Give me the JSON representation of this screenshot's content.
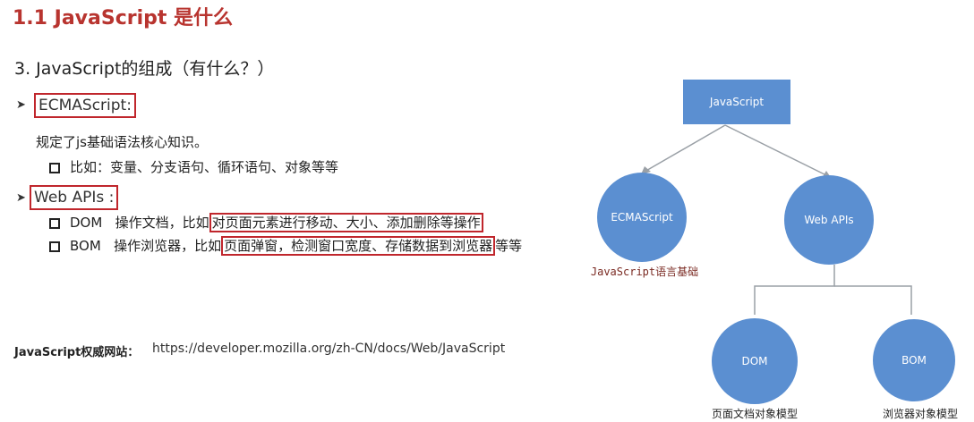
{
  "title": "1.1 JavaScript 是什么",
  "heading": "3. JavaScript的组成（有什么？）",
  "ecma": {
    "label": "ECMAScript:",
    "desc": "规定了js基础语法核心知识。",
    "example": "比如：变量、分支语句、循环语句、对象等等"
  },
  "webapis": {
    "label": "Web APIs :",
    "dom_prefix": "DOM   操作文档，比如",
    "dom_highlight": "对页面元素进行移动、大小、添加删除等操作",
    "bom_prefix": "BOM   操作浏览器，比如",
    "bom_highlight": "页面弹窗，检测窗口宽度、存储数据到浏览器",
    "bom_suffix": "等等"
  },
  "site": {
    "label": "JavaScript权威网站：",
    "url": "https://developer.mozilla.org/zh-CN/docs/Web/JavaScript"
  },
  "diagram": {
    "root": "JavaScript",
    "ecma_node": "ECMAScript",
    "ecma_sub": "JavaScript语言基础",
    "webapis_node": "Web APIs",
    "dom_node": "DOM",
    "dom_sub": "页面文档对象模型",
    "bom_node": "BOM",
    "bom_sub": "浏览器对象模型"
  },
  "colors": {
    "title": "#b8342f",
    "highlight_border": "#c0262c",
    "node_fill": "#5b8fd1",
    "connector": "#9aa0a6"
  }
}
